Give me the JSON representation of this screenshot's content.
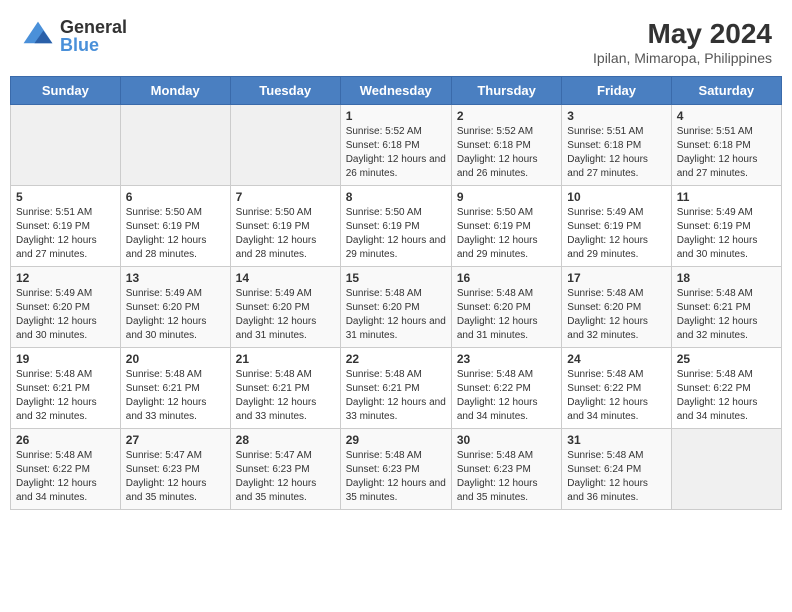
{
  "header": {
    "logo_line1": "General",
    "logo_line2": "Blue",
    "month_year": "May 2024",
    "location": "Ipilan, Mimaropa, Philippines"
  },
  "days_of_week": [
    "Sunday",
    "Monday",
    "Tuesday",
    "Wednesday",
    "Thursday",
    "Friday",
    "Saturday"
  ],
  "weeks": [
    [
      {
        "day": "",
        "info": ""
      },
      {
        "day": "",
        "info": ""
      },
      {
        "day": "",
        "info": ""
      },
      {
        "day": "1",
        "info": "Sunrise: 5:52 AM\nSunset: 6:18 PM\nDaylight: 12 hours and 26 minutes."
      },
      {
        "day": "2",
        "info": "Sunrise: 5:52 AM\nSunset: 6:18 PM\nDaylight: 12 hours and 26 minutes."
      },
      {
        "day": "3",
        "info": "Sunrise: 5:51 AM\nSunset: 6:18 PM\nDaylight: 12 hours and 27 minutes."
      },
      {
        "day": "4",
        "info": "Sunrise: 5:51 AM\nSunset: 6:18 PM\nDaylight: 12 hours and 27 minutes."
      }
    ],
    [
      {
        "day": "5",
        "info": "Sunrise: 5:51 AM\nSunset: 6:19 PM\nDaylight: 12 hours and 27 minutes."
      },
      {
        "day": "6",
        "info": "Sunrise: 5:50 AM\nSunset: 6:19 PM\nDaylight: 12 hours and 28 minutes."
      },
      {
        "day": "7",
        "info": "Sunrise: 5:50 AM\nSunset: 6:19 PM\nDaylight: 12 hours and 28 minutes."
      },
      {
        "day": "8",
        "info": "Sunrise: 5:50 AM\nSunset: 6:19 PM\nDaylight: 12 hours and 29 minutes."
      },
      {
        "day": "9",
        "info": "Sunrise: 5:50 AM\nSunset: 6:19 PM\nDaylight: 12 hours and 29 minutes."
      },
      {
        "day": "10",
        "info": "Sunrise: 5:49 AM\nSunset: 6:19 PM\nDaylight: 12 hours and 29 minutes."
      },
      {
        "day": "11",
        "info": "Sunrise: 5:49 AM\nSunset: 6:19 PM\nDaylight: 12 hours and 30 minutes."
      }
    ],
    [
      {
        "day": "12",
        "info": "Sunrise: 5:49 AM\nSunset: 6:20 PM\nDaylight: 12 hours and 30 minutes."
      },
      {
        "day": "13",
        "info": "Sunrise: 5:49 AM\nSunset: 6:20 PM\nDaylight: 12 hours and 30 minutes."
      },
      {
        "day": "14",
        "info": "Sunrise: 5:49 AM\nSunset: 6:20 PM\nDaylight: 12 hours and 31 minutes."
      },
      {
        "day": "15",
        "info": "Sunrise: 5:48 AM\nSunset: 6:20 PM\nDaylight: 12 hours and 31 minutes."
      },
      {
        "day": "16",
        "info": "Sunrise: 5:48 AM\nSunset: 6:20 PM\nDaylight: 12 hours and 31 minutes."
      },
      {
        "day": "17",
        "info": "Sunrise: 5:48 AM\nSunset: 6:20 PM\nDaylight: 12 hours and 32 minutes."
      },
      {
        "day": "18",
        "info": "Sunrise: 5:48 AM\nSunset: 6:21 PM\nDaylight: 12 hours and 32 minutes."
      }
    ],
    [
      {
        "day": "19",
        "info": "Sunrise: 5:48 AM\nSunset: 6:21 PM\nDaylight: 12 hours and 32 minutes."
      },
      {
        "day": "20",
        "info": "Sunrise: 5:48 AM\nSunset: 6:21 PM\nDaylight: 12 hours and 33 minutes."
      },
      {
        "day": "21",
        "info": "Sunrise: 5:48 AM\nSunset: 6:21 PM\nDaylight: 12 hours and 33 minutes."
      },
      {
        "day": "22",
        "info": "Sunrise: 5:48 AM\nSunset: 6:21 PM\nDaylight: 12 hours and 33 minutes."
      },
      {
        "day": "23",
        "info": "Sunrise: 5:48 AM\nSunset: 6:22 PM\nDaylight: 12 hours and 34 minutes."
      },
      {
        "day": "24",
        "info": "Sunrise: 5:48 AM\nSunset: 6:22 PM\nDaylight: 12 hours and 34 minutes."
      },
      {
        "day": "25",
        "info": "Sunrise: 5:48 AM\nSunset: 6:22 PM\nDaylight: 12 hours and 34 minutes."
      }
    ],
    [
      {
        "day": "26",
        "info": "Sunrise: 5:48 AM\nSunset: 6:22 PM\nDaylight: 12 hours and 34 minutes."
      },
      {
        "day": "27",
        "info": "Sunrise: 5:47 AM\nSunset: 6:23 PM\nDaylight: 12 hours and 35 minutes."
      },
      {
        "day": "28",
        "info": "Sunrise: 5:47 AM\nSunset: 6:23 PM\nDaylight: 12 hours and 35 minutes."
      },
      {
        "day": "29",
        "info": "Sunrise: 5:48 AM\nSunset: 6:23 PM\nDaylight: 12 hours and 35 minutes."
      },
      {
        "day": "30",
        "info": "Sunrise: 5:48 AM\nSunset: 6:23 PM\nDaylight: 12 hours and 35 minutes."
      },
      {
        "day": "31",
        "info": "Sunrise: 5:48 AM\nSunset: 6:24 PM\nDaylight: 12 hours and 36 minutes."
      },
      {
        "day": "",
        "info": ""
      }
    ]
  ]
}
